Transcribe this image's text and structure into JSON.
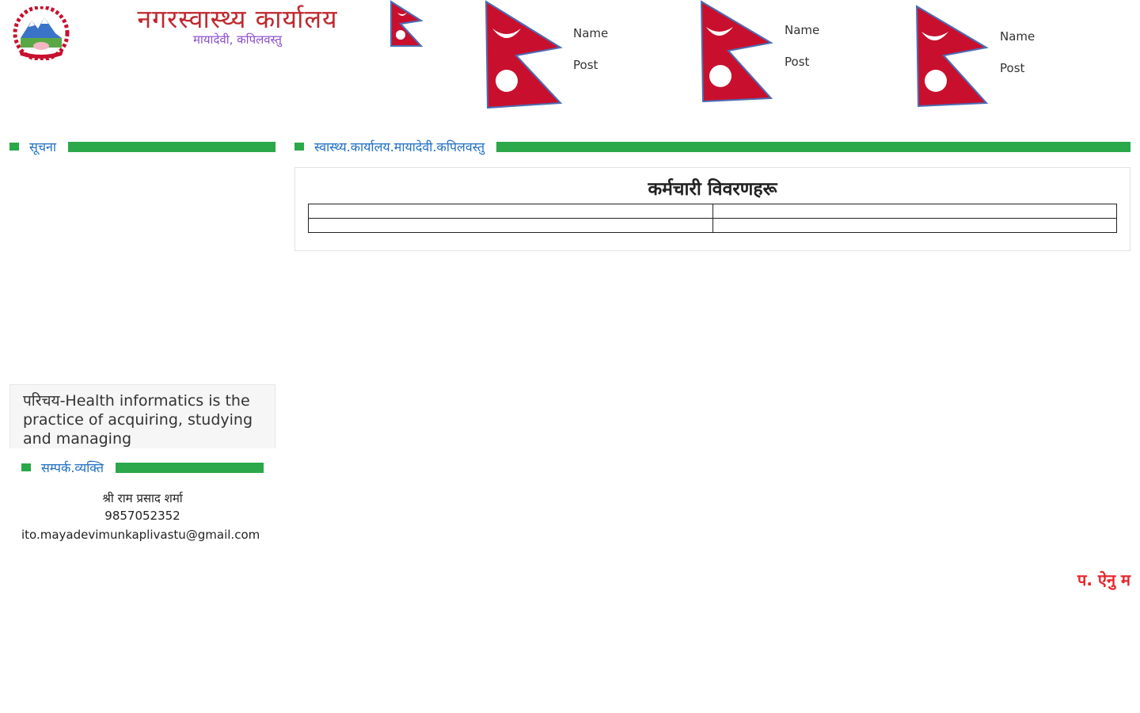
{
  "header": {
    "title": "नगरस्वास्थ्य कार्यालय",
    "subtitle": "मायादेवी, कपिलवस्तु",
    "emblem_icon": "nepal-emblem-icon",
    "flag_icon": "nepal-flag-icon"
  },
  "officials": [
    {
      "name": "Name",
      "post": "Post"
    },
    {
      "name": "Name",
      "post": "Post"
    },
    {
      "name": "Name",
      "post": "Post"
    }
  ],
  "sidebar": {
    "notice_heading": "सूचना",
    "info_text": "परिचय-Health informatics is the practice of acquiring, studying and managing",
    "contact_heading": "सम्पर्क.व्यक्ति",
    "contact_name": "श्री राम प्रसाद शर्मा",
    "contact_phone": "9857052352",
    "contact_email": "ito.mayadevimunkaplivastu@gmail.com"
  },
  "main": {
    "heading": "स्वास्थ्य.कार्यालय.मायादेवी.कपिलवस्तु",
    "box_title": "कर्मचारी विवरणहरू"
  },
  "footer": {
    "tag": "प. ऐनु म"
  },
  "colors": {
    "accent_green": "#2aa84a",
    "link_blue": "#1e6fc5",
    "title_red": "#c0282d",
    "subtitle_purple": "#8a4dcf",
    "flag_crimson": "#c8102e",
    "flag_blue": "#4a6fb5"
  }
}
